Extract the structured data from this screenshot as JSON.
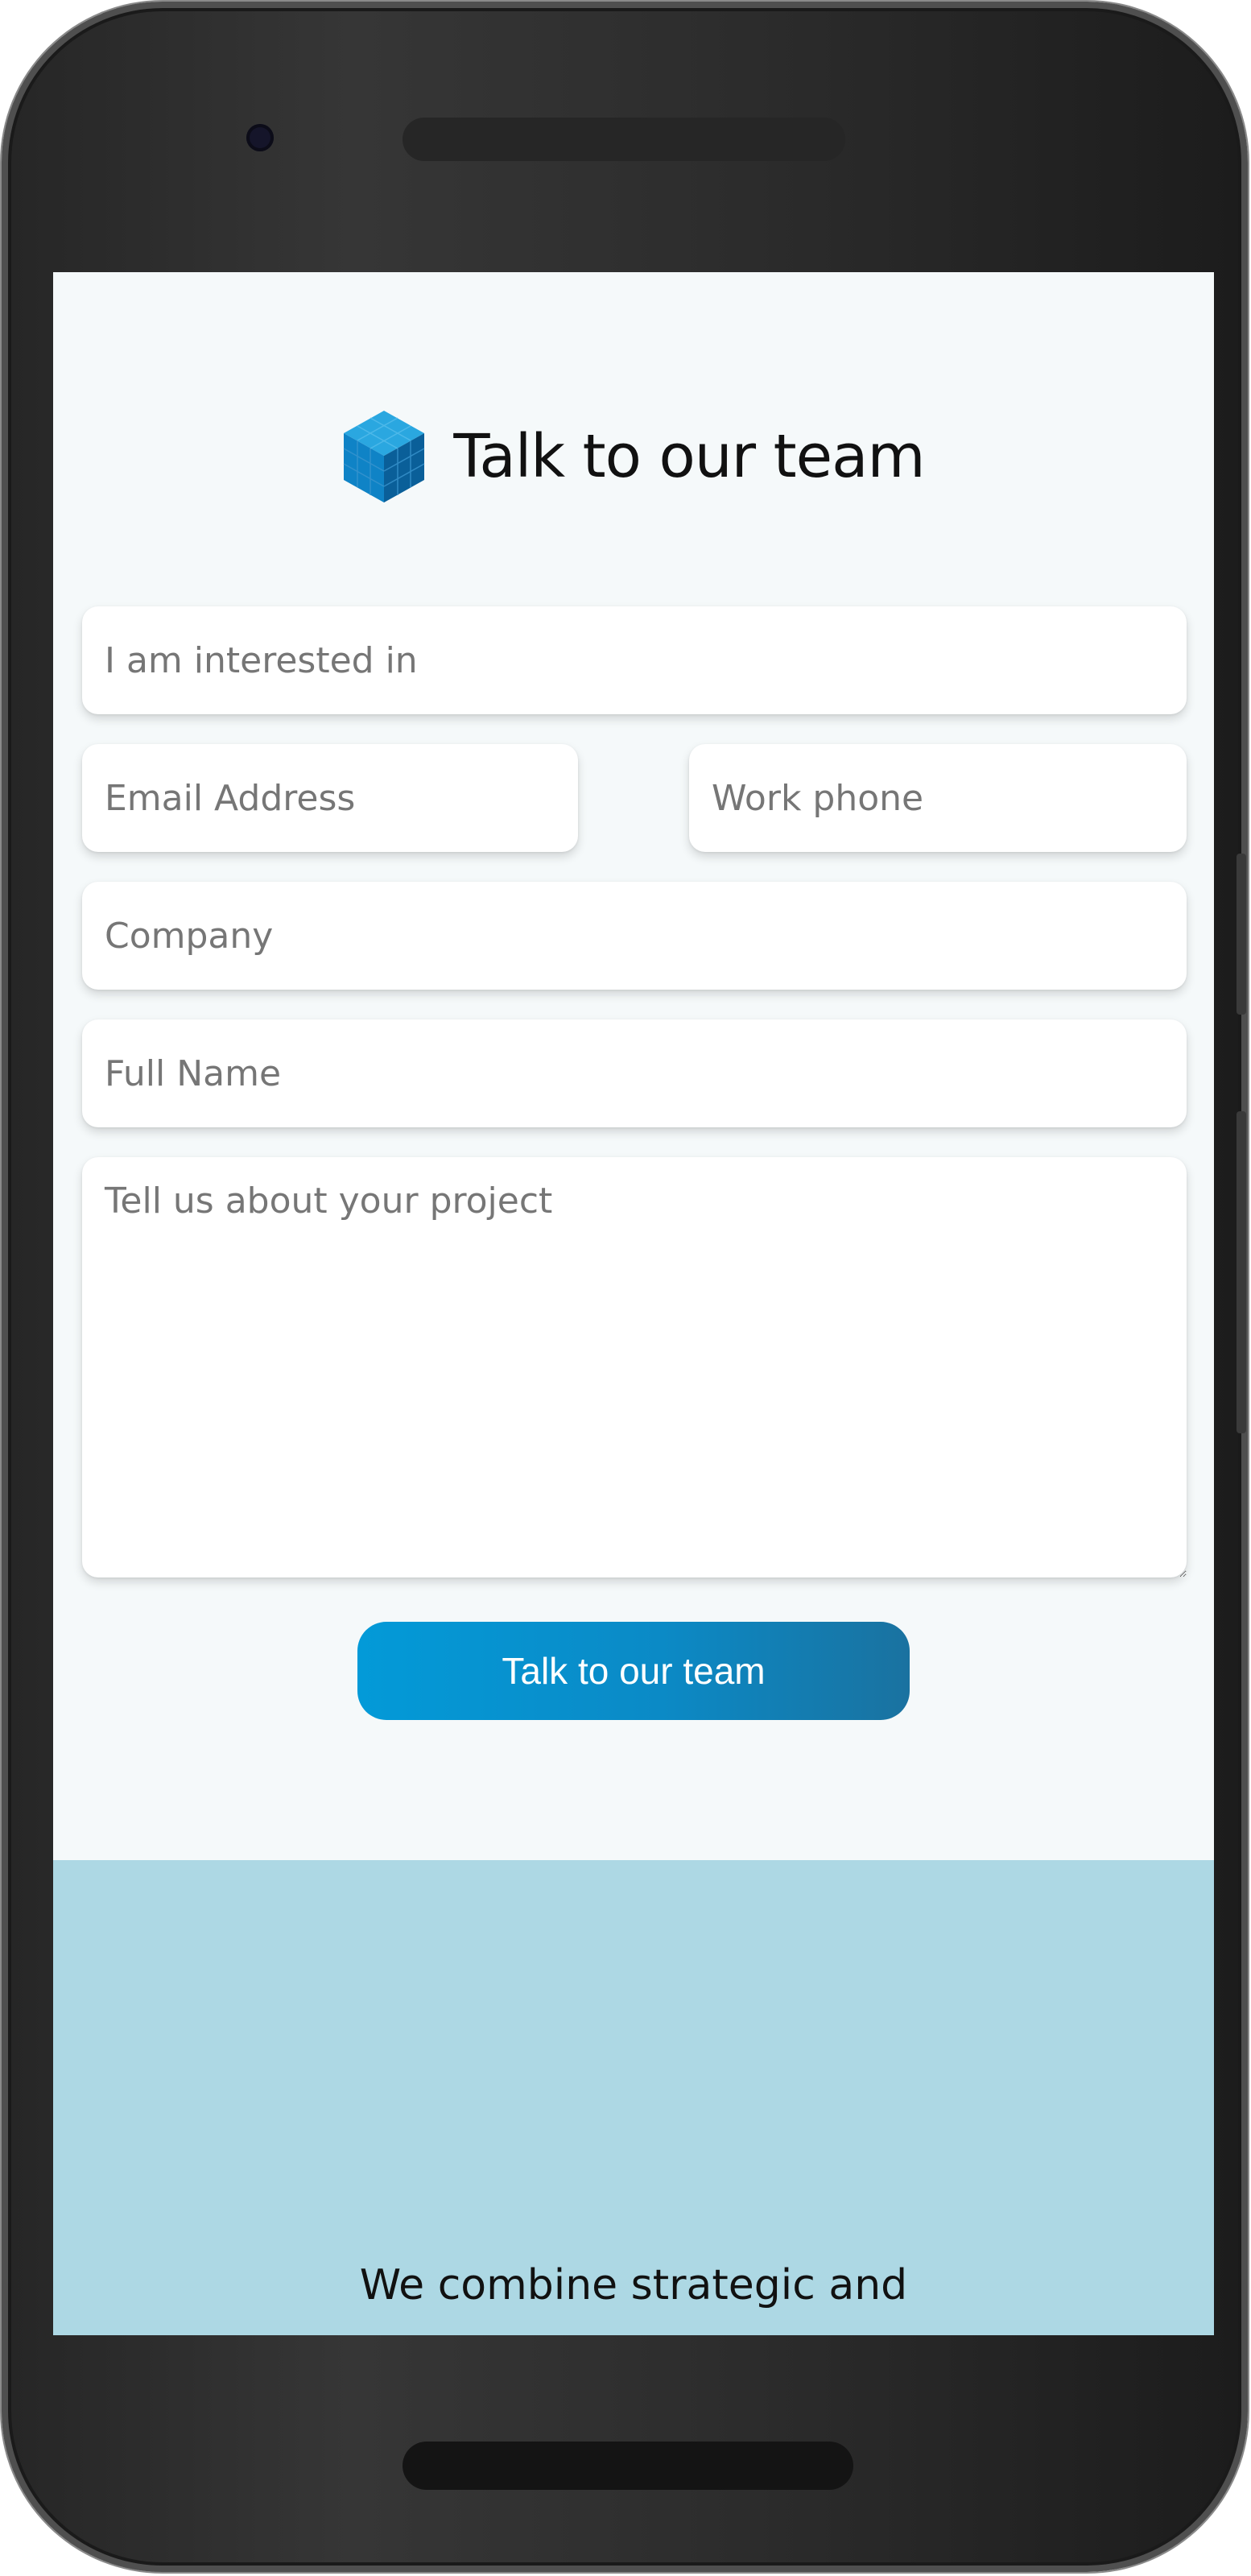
{
  "header": {
    "title": "Talk to our team",
    "logo_icon": "cube-icon",
    "logo_colors": {
      "light": "#2aa7e0",
      "mid": "#0f83c6",
      "dark": "#0a5f99"
    }
  },
  "form": {
    "interest_placeholder": "I am interested in",
    "email_placeholder": "Email Address",
    "phone_placeholder": "Work phone",
    "company_placeholder": "Company",
    "fullname_placeholder": "Full Name",
    "project_placeholder": "Tell us about your project",
    "submit_label": "Talk to our team"
  },
  "section_two": {
    "tagline": "We combine strategic and"
  },
  "colors": {
    "page_background": "#f5f9fa",
    "section_background": "#add8e4",
    "button_gradient_start": "#039ad8",
    "button_gradient_end": "#1a72a0",
    "button_text": "#ffffff"
  }
}
